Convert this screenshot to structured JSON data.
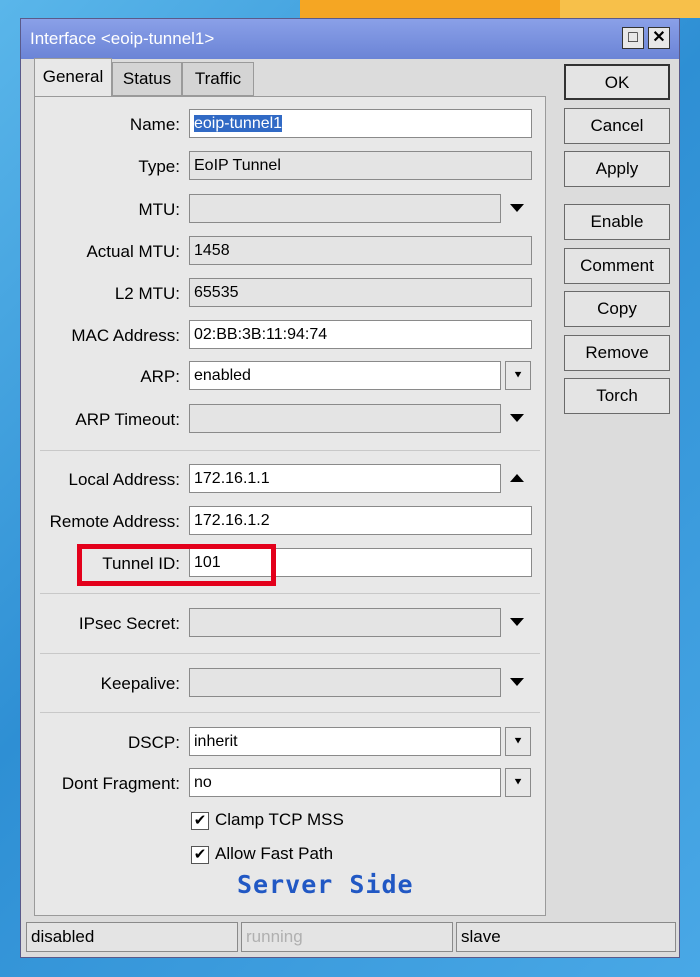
{
  "window": {
    "title": "Interface <eoip-tunnel1>",
    "maximize_glyph": "□",
    "close_glyph": "✕"
  },
  "tabs": [
    "General",
    "Status",
    "Traffic"
  ],
  "fields": {
    "name": {
      "label": "Name:",
      "value": "eoip-tunnel1"
    },
    "type": {
      "label": "Type:",
      "value": "EoIP Tunnel"
    },
    "mtu": {
      "label": "MTU:",
      "value": ""
    },
    "actual_mtu": {
      "label": "Actual MTU:",
      "value": "1458"
    },
    "l2_mtu": {
      "label": "L2 MTU:",
      "value": "65535"
    },
    "mac": {
      "label": "MAC Address:",
      "value": "02:BB:3B:11:94:74"
    },
    "arp": {
      "label": "ARP:",
      "value": "enabled"
    },
    "arp_timeout": {
      "label": "ARP Timeout:",
      "value": ""
    },
    "local_address": {
      "label": "Local Address:",
      "value": "172.16.1.1"
    },
    "remote_address": {
      "label": "Remote Address:",
      "value": "172.16.1.2"
    },
    "tunnel_id": {
      "label": "Tunnel ID:",
      "value": "101"
    },
    "ipsec_secret": {
      "label": "IPsec Secret:",
      "value": ""
    },
    "keepalive": {
      "label": "Keepalive:",
      "value": ""
    },
    "dscp": {
      "label": "DSCP:",
      "value": "inherit"
    },
    "dont_fragment": {
      "label": "Dont Fragment:",
      "value": "no"
    }
  },
  "checkboxes": {
    "clamp_tcp_mss": {
      "label": "Clamp TCP MSS",
      "checked": true
    },
    "allow_fast_path": {
      "label": "Allow Fast Path",
      "checked": true
    }
  },
  "check_glyph": "✔",
  "spin_glyph": "⯆",
  "buttons": [
    "OK",
    "Cancel",
    "Apply",
    "Enable",
    "Comment",
    "Copy",
    "Remove",
    "Torch"
  ],
  "status_bar": [
    "disabled",
    "running",
    "slave"
  ],
  "watermark": "Server Side",
  "colors": {
    "highlight": "#e3001b",
    "watermark": "#2158c4",
    "titlebar": "#7890de"
  }
}
